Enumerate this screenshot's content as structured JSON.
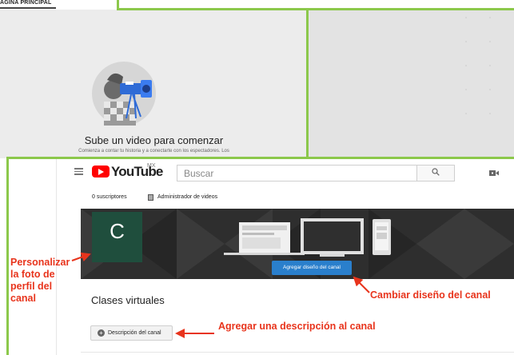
{
  "background": {
    "top_tab_label": "ÁGINA PRINCIPAL",
    "empty_state_title": "Sube un video para comenzar",
    "empty_state_description": "Comienza a contar tu historia y a conectarte con los espectadores. Los"
  },
  "header": {
    "logo_text": "YouTube",
    "country_code": "MX",
    "search_placeholder": "Buscar"
  },
  "subheader": {
    "subscribers": "0 suscriptores",
    "video_manager": "Administrador de videos"
  },
  "channel": {
    "avatar_letter": "C",
    "customize_button": "Agregar diseño del canal",
    "name": "Clases virtuales",
    "description_button": "Descripción del canal"
  },
  "annotations": {
    "profile_photo": "Personalizar la foto de perfil del canal",
    "channel_design": "Cambiar diseño del canal",
    "add_description": "Agregar una descripción al canal"
  },
  "colors": {
    "accent_green": "#8cc84b",
    "annotation_red": "#e8341c",
    "youtube_red": "#ff0000",
    "button_blue": "#2a7fcc",
    "avatar_green": "#1f4e3d"
  }
}
